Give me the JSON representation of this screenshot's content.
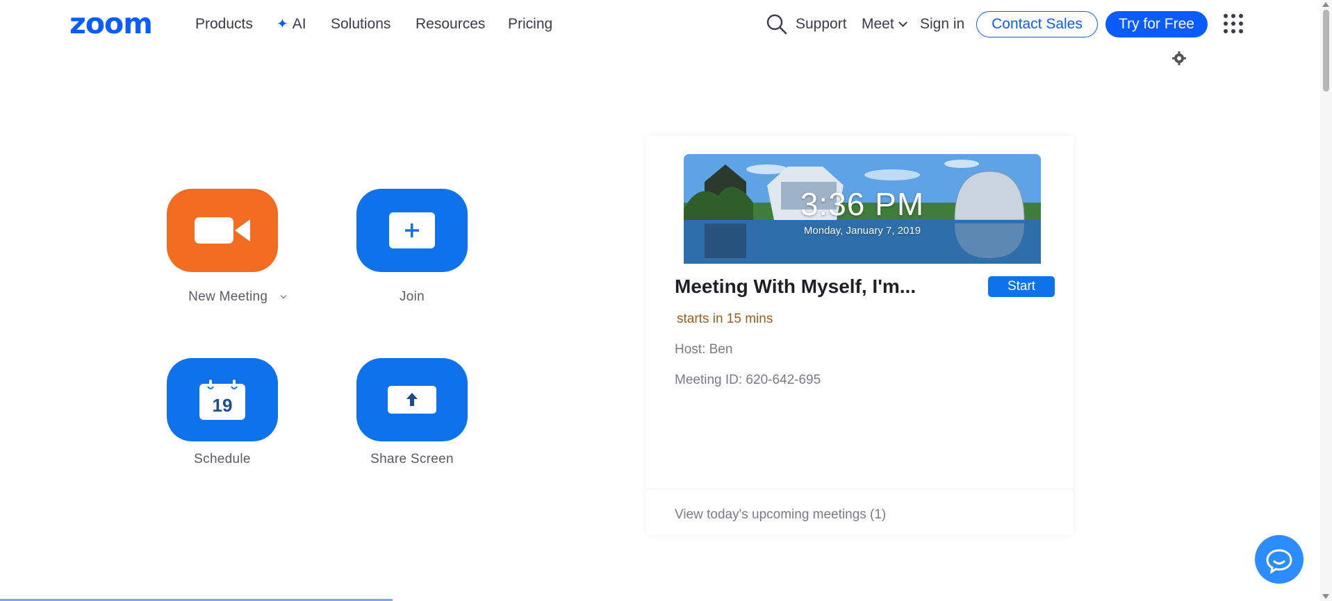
{
  "nav": {
    "logo": "zoom",
    "links": [
      "Products",
      "AI",
      "Solutions",
      "Resources",
      "Pricing"
    ],
    "support": "Support",
    "meet": "Meet",
    "sign_in": "Sign in",
    "contact_sales": "Contact Sales",
    "try_free": "Try for Free"
  },
  "actions": {
    "new_meeting": "New Meeting",
    "join": "Join",
    "schedule": "Schedule",
    "schedule_day": "19",
    "share_screen": "Share Screen"
  },
  "meeting_card": {
    "time": "3:36 PM",
    "date": "Monday, January 7, 2019",
    "title": "Meeting With Myself, I'm...",
    "start_label": "Start",
    "starts_in": "starts in 15 mins",
    "host": "Host: Ben",
    "meeting_id": "Meeting ID: 620-642-695",
    "upcoming": "View today's upcoming meetings (1)"
  },
  "colors": {
    "brand": "#0b5cff",
    "orange_tile": "#f26d21",
    "blue_tile": "#0e72ed"
  }
}
